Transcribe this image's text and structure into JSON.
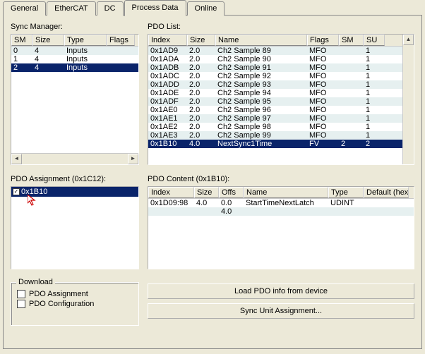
{
  "tabs": [
    "General",
    "EtherCAT",
    "DC",
    "Process Data",
    "Online"
  ],
  "activeTab": 3,
  "syncManager": {
    "label": "Sync Manager:",
    "headers": [
      "SM",
      "Size",
      "Type",
      "Flags"
    ],
    "rows": [
      {
        "sm": "0",
        "size": "4",
        "type": "Inputs",
        "flags": ""
      },
      {
        "sm": "1",
        "size": "4",
        "type": "Inputs",
        "flags": ""
      },
      {
        "sm": "2",
        "size": "4",
        "type": "Inputs",
        "flags": ""
      }
    ],
    "selected": 2
  },
  "pdoList": {
    "label": "PDO List:",
    "headers": [
      "Index",
      "Size",
      "Name",
      "Flags",
      "SM",
      "SU"
    ],
    "rows": [
      {
        "index": "0x1AD9",
        "size": "2.0",
        "name": "Ch2 Sample 89",
        "flags": "MFO",
        "sm": "",
        "su": "1"
      },
      {
        "index": "0x1ADA",
        "size": "2.0",
        "name": "Ch2 Sample 90",
        "flags": "MFO",
        "sm": "",
        "su": "1"
      },
      {
        "index": "0x1ADB",
        "size": "2.0",
        "name": "Ch2 Sample 91",
        "flags": "MFO",
        "sm": "",
        "su": "1"
      },
      {
        "index": "0x1ADC",
        "size": "2.0",
        "name": "Ch2 Sample 92",
        "flags": "MFO",
        "sm": "",
        "su": "1"
      },
      {
        "index": "0x1ADD",
        "size": "2.0",
        "name": "Ch2 Sample 93",
        "flags": "MFO",
        "sm": "",
        "su": "1"
      },
      {
        "index": "0x1ADE",
        "size": "2.0",
        "name": "Ch2 Sample 94",
        "flags": "MFO",
        "sm": "",
        "su": "1"
      },
      {
        "index": "0x1ADF",
        "size": "2.0",
        "name": "Ch2 Sample 95",
        "flags": "MFO",
        "sm": "",
        "su": "1"
      },
      {
        "index": "0x1AE0",
        "size": "2.0",
        "name": "Ch2 Sample 96",
        "flags": "MFO",
        "sm": "",
        "su": "1"
      },
      {
        "index": "0x1AE1",
        "size": "2.0",
        "name": "Ch2 Sample 97",
        "flags": "MFO",
        "sm": "",
        "su": "1"
      },
      {
        "index": "0x1AE2",
        "size": "2.0",
        "name": "Ch2 Sample 98",
        "flags": "MFO",
        "sm": "",
        "su": "1"
      },
      {
        "index": "0x1AE3",
        "size": "2.0",
        "name": "Ch2 Sample 99",
        "flags": "MFO",
        "sm": "",
        "su": "1"
      },
      {
        "index": "0x1B10",
        "size": "4.0",
        "name": "NextSync1Time",
        "flags": "FV",
        "sm": "2",
        "su": "2"
      }
    ],
    "selected": 11
  },
  "pdoAssignment": {
    "label": "PDO Assignment (0x1C12):",
    "item": "0x1B10",
    "checked": true
  },
  "pdoContent": {
    "label": "PDO Content (0x1B10):",
    "headers": [
      "Index",
      "Size",
      "Offs",
      "Name",
      "Type",
      "Default (hex)"
    ],
    "rows": [
      {
        "index": "0x1D09:98",
        "size": "4.0",
        "offs": "0.0",
        "name": "StartTimeNextLatch",
        "type": "UDINT",
        "def": ""
      },
      {
        "index": "",
        "size": "",
        "offs": "4.0",
        "name": "",
        "type": "",
        "def": ""
      }
    ]
  },
  "download": {
    "label": "Download",
    "optA": "PDO Assignment",
    "optB": "PDO Configuration"
  },
  "buttons": {
    "load": "Load PDO info from device",
    "sync": "Sync Unit Assignment..."
  }
}
